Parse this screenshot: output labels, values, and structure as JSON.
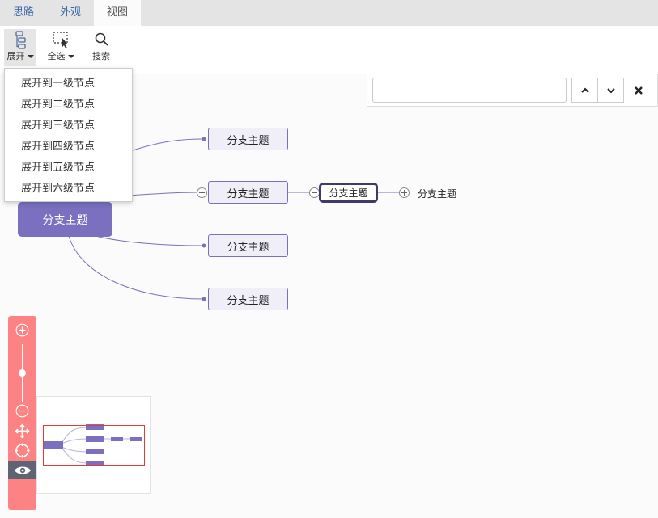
{
  "tabs": [
    {
      "label": "思路",
      "active": false
    },
    {
      "label": "外观",
      "active": false
    },
    {
      "label": "视图",
      "active": true
    }
  ],
  "toolbar": {
    "expand_label": "展开",
    "select_all_label": "全选",
    "search_label": "搜索"
  },
  "expand_menu": {
    "items": [
      "展开到一级节点",
      "展开到二级节点",
      "展开到三级节点",
      "展开到四级节点",
      "展开到五级节点",
      "展开到六级节点"
    ]
  },
  "search": {
    "value": "",
    "placeholder": "",
    "prev_icon": "chevron-up-icon",
    "next_icon": "chevron-down-icon",
    "close_icon": "close-icon"
  },
  "mindmap": {
    "main_topic": "分支主题",
    "branches": [
      "分支主题",
      "分支主题",
      "分支主题",
      "分支主题"
    ],
    "sub_topic_selected": "分支主题",
    "sub_sub_topic": "分支主题"
  },
  "zoom": {
    "level": 0.5,
    "zoom_in_icon": "zoom-in-icon",
    "zoom_out_icon": "zoom-out-icon",
    "move_icon": "move-icon",
    "locate_icon": "target-icon",
    "navigator_icon": "eye-icon"
  },
  "colors": {
    "main_node": "#7a70bf",
    "branch_fill": "#f0eff8",
    "selected_border": "#3f3a6b",
    "zoombar": "#fd8283",
    "viewport": "#e53935"
  }
}
